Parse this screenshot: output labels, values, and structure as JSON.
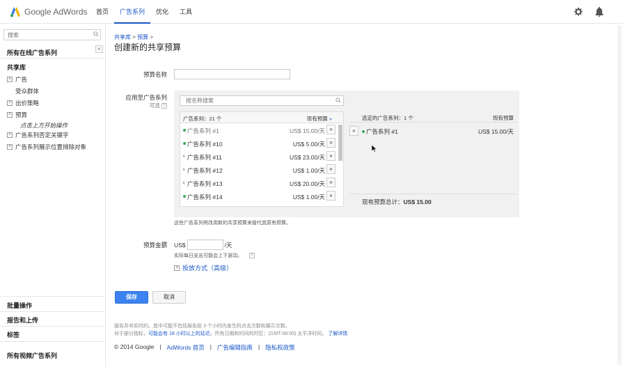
{
  "header": {
    "logo_google": "Google",
    "logo_adwords": "AdWords",
    "nav": [
      "首页",
      "广告系列",
      "优化",
      "工具"
    ],
    "active_nav": 1
  },
  "sidebar": {
    "search_placeholder": "搜索",
    "collapse": "«",
    "all_campaigns": "所有在线广告系列",
    "shared_library": "共享库",
    "items": [
      {
        "label": "广告",
        "expandable": true
      },
      {
        "label": "受众群体",
        "expandable": false
      },
      {
        "label": "出价策略",
        "expandable": true
      },
      {
        "label": "预算",
        "expandable": true
      },
      {
        "label": "点击上方开始操作",
        "hint": true
      },
      {
        "label": "广告系列否定关键字",
        "expandable": true
      },
      {
        "label": "广告系列展示位置排除对象",
        "expandable": true
      }
    ],
    "bulk_ops": "批量操作",
    "reports": "报告和上传",
    "labels": "标签",
    "all_video": "所有视频广告系列"
  },
  "main": {
    "breadcrumb": [
      "共享库",
      "预算"
    ],
    "breadcrumb_sep": ">",
    "title": "创建新的共享预算",
    "budget_name_label": "预算名称",
    "budget_name_value": "",
    "apply_label": "应用至广告系列",
    "optional": "可选",
    "help": "?",
    "apply_search_placeholder": "按名称搜索",
    "list_header_left": "广告系列：21 个",
    "list_header_right": "现有预算",
    "list_header_arrow": "»",
    "add_btn": "»",
    "campaigns": [
      {
        "name": "广告系列 #1",
        "amount": "US$ 15.00/天",
        "status": "active",
        "dim": true
      },
      {
        "name": "广告系列 #10",
        "amount": "US$ 5.00/天",
        "status": "active",
        "dim": false
      },
      {
        "name": "广告系列 #11",
        "amount": "US$ 23.00/天",
        "status": "paused",
        "dim": false
      },
      {
        "name": "广告系列 #12",
        "amount": "US$ 1.00/天",
        "status": "paused",
        "dim": false
      },
      {
        "name": "广告系列 #13",
        "amount": "US$ 20.00/天",
        "status": "paused",
        "dim": false
      },
      {
        "name": "广告系列 #14",
        "amount": "US$ 1.00/天",
        "status": "active",
        "dim": false
      }
    ],
    "selected_header_left": "选定的广告系列：1 个",
    "selected_header_right": "现有预算",
    "remove_btn": "«",
    "selected": {
      "name": "广告系列 #1",
      "amount": "US$ 15.00/天"
    },
    "total_label": "现有预算总计：",
    "total_value": "US$ 15.00",
    "apply_note": "这些广告系列将改用新的共享预算来替代其原有预算。",
    "budget_amount_label": "预算金额",
    "currency": "US$",
    "budget_amount_value": "",
    "per_day": "/天",
    "budget_note": "实际每日支出可能会上下波动。",
    "delivery": "投放方式（高级）",
    "save": "保存",
    "cancel": "取消",
    "footnote1": "报告并非实时的。其中可能不包括报告前 3 个小时内发生的点击次数和展示次数。",
    "footnote2_a": "对于部分指标，",
    "footnote2_link": "可能会有 18 小时以上的延迟",
    "footnote2_b": "。所有日期和时间的时区：(GMT-08:00) 太平洋时间。",
    "footnote2_more": "了解详情",
    "footer_copy": "© 2014 Google",
    "footer_links": [
      "AdWords 首页",
      "广告编辑指南",
      "隐私权政策"
    ],
    "footer_sep": "|"
  },
  "colors": {
    "accent": "#1a57c9",
    "save": "#3d83f0",
    "active_dot": "#3aa757"
  }
}
